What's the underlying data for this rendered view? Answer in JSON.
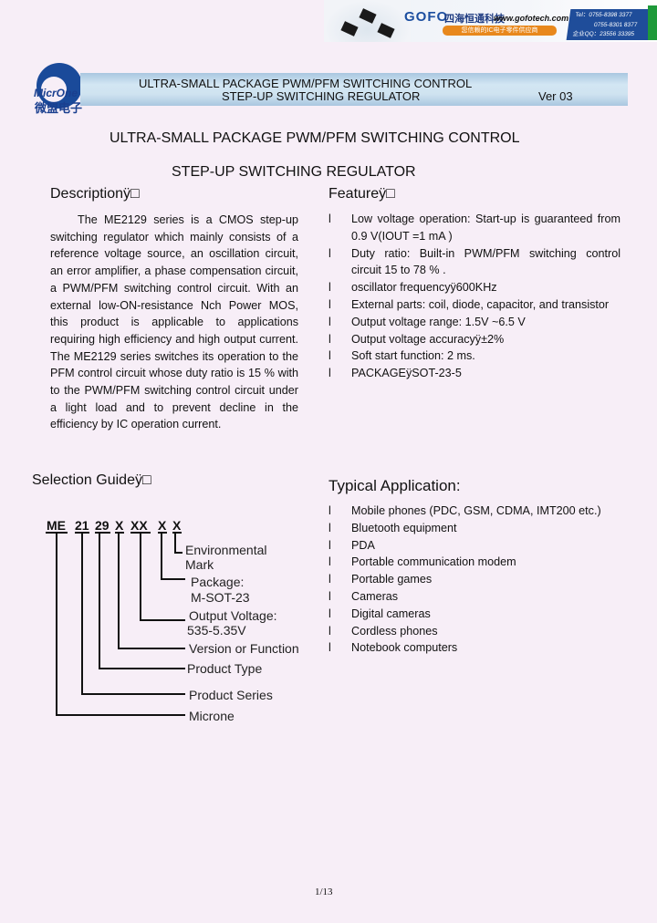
{
  "banner": {
    "brand": "GOFO",
    "company_cn": "四海恒通科技",
    "url": "www.gofotech.com",
    "slogan": "您信赖的IC电子零件供应商",
    "contact": [
      "Tel：0755-8398 3377",
      "0755-8301 8377",
      "企业QQ：23556 33395"
    ]
  },
  "logo": {
    "name": "MicrOne",
    "name_cn": "微盟电子"
  },
  "header": {
    "line1": "ULTRA-SMALL PACKAGE PWM/PFM SWITCHING CONTROL",
    "line2": "STEP-UP SWITCHING REGULATOR",
    "version": "Ver 03"
  },
  "title": {
    "line1": "ULTRA-SMALL PACKAGE PWM/PFM SWITCHING CONTROL",
    "line2": "STEP-UP SWITCHING REGULATOR"
  },
  "description": {
    "heading": "Descriptionÿ□",
    "text": "The ME2129 series is a CMOS step-up switching regulator which mainly consists of a reference voltage source, an oscillation circuit, an error amplifier, a phase compensation circuit, a PWM/PFM switching control circuit. With an external low-ON-resistance Nch Power MOS, this product is applicable to applications requiring high efficiency and high output current. The ME2129 series switches its operation to the PFM control circuit whose duty ratio is 15 % with to the PWM/PFM switching control circuit under a light load and to prevent decline in the efficiency by IC operation current."
  },
  "features": {
    "heading": "Featureÿ□",
    "bullet": "l",
    "items": [
      "Low voltage operation: Start-up is guaranteed from 0.9 V(IOUT =1 mA )",
      "Duty ratio: Built-in PWM/PFM switching control circuit 15 to 78 % .",
      "oscillator frequencyÿ600KHz",
      "External parts: coil, diode, capacitor, and transistor",
      "Output voltage range: 1.5V ~6.5 V",
      "Output voltage accuracyÿ±2%",
      "Soft start function: 2 ms.",
      "PACKAGEÿSOT-23-5"
    ]
  },
  "selection": {
    "heading": "Selection Guideÿ□",
    "code": [
      "ME",
      "21",
      "29",
      "X",
      "XX",
      "X",
      "X"
    ],
    "labels": {
      "env1": "Environmental",
      "env2": "Mark",
      "pkg1": "Package:",
      "pkg2": "M-SOT-23",
      "ov1": "Output Voltage:",
      "ov2": "535-5.35V",
      "ver": "Version or Function",
      "type": "Product Type",
      "series": "Product Series",
      "micro": "Microne"
    }
  },
  "applications": {
    "heading": "Typical Application:",
    "bullet": "l",
    "items": [
      "Mobile phones (PDC, GSM, CDMA, IMT200 etc.)",
      "Bluetooth equipment",
      "PDA",
      "Portable communication modem",
      "Portable games",
      "Cameras",
      "Digital cameras",
      "Cordless phones",
      "Notebook computers"
    ]
  },
  "page": "1/13"
}
